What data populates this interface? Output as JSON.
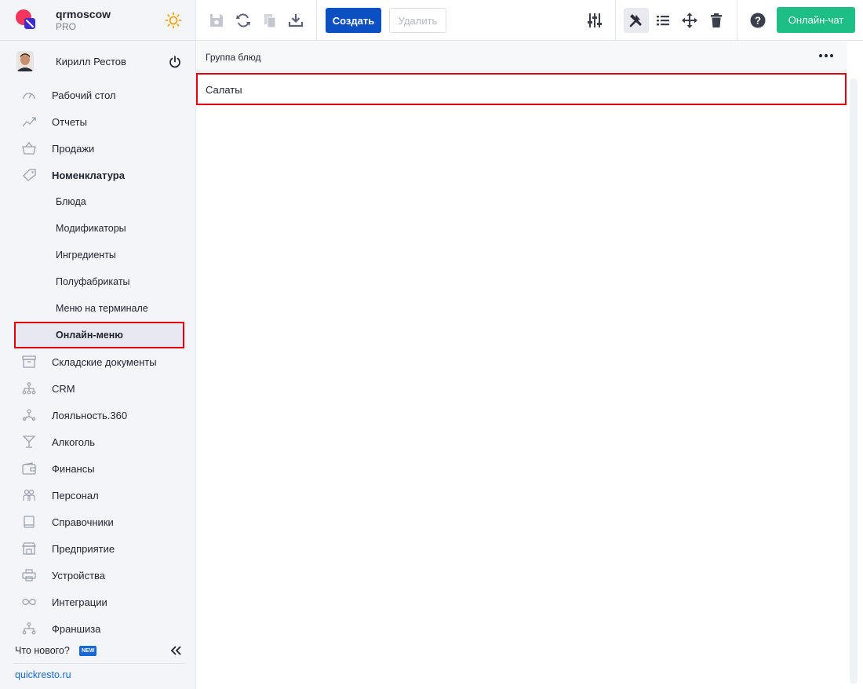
{
  "brand": {
    "name": "qrmoscow",
    "plan": "PRO",
    "logo_colors": [
      "#f5365c",
      "#3d2bd6"
    ]
  },
  "user": {
    "name": "Кирилл Рестов"
  },
  "nav": {
    "items": [
      {
        "label": "Рабочий стол",
        "icon": "dashboard-icon"
      },
      {
        "label": "Отчеты",
        "icon": "chart-icon"
      },
      {
        "label": "Продажи",
        "icon": "basket-icon"
      },
      {
        "label": "Номенклатура",
        "icon": "tag-icon"
      }
    ],
    "sub_items": [
      {
        "label": "Блюда"
      },
      {
        "label": "Модификаторы"
      },
      {
        "label": "Ингредиенты"
      },
      {
        "label": "Полуфабрикаты"
      },
      {
        "label": "Меню на терминале"
      },
      {
        "label": "Онлайн-меню"
      }
    ],
    "items_after": [
      {
        "label": "Складские документы",
        "icon": "archive-icon"
      },
      {
        "label": "CRM",
        "icon": "hierarchy-icon"
      },
      {
        "label": "Лояльность.360",
        "icon": "loyalty-icon"
      },
      {
        "label": "Алкоголь",
        "icon": "cocktail-icon"
      },
      {
        "label": "Финансы",
        "icon": "wallet-icon"
      },
      {
        "label": "Персонал",
        "icon": "people-icon"
      },
      {
        "label": "Справочники",
        "icon": "book-icon"
      },
      {
        "label": "Предприятие",
        "icon": "store-icon"
      },
      {
        "label": "Устройства",
        "icon": "printer-icon"
      },
      {
        "label": "Интеграции",
        "icon": "infinity-icon"
      },
      {
        "label": "Франшиза",
        "icon": "franchise-icon"
      }
    ]
  },
  "whats_new": {
    "label": "Что нового?",
    "badge": "NEW"
  },
  "footer": {
    "link": "quickresto.ru"
  },
  "toolbar": {
    "create_label": "Создать",
    "delete_label": "Удалить",
    "chat_label": "Онлайн-чат"
  },
  "grid": {
    "column_header": "Группа блюд",
    "rows": [
      {
        "name": "Салаты"
      }
    ]
  },
  "colors": {
    "accent": "#0b4fc3",
    "chat": "#1dbf86",
    "highlight": "#e3000f",
    "link": "#1769d6"
  }
}
